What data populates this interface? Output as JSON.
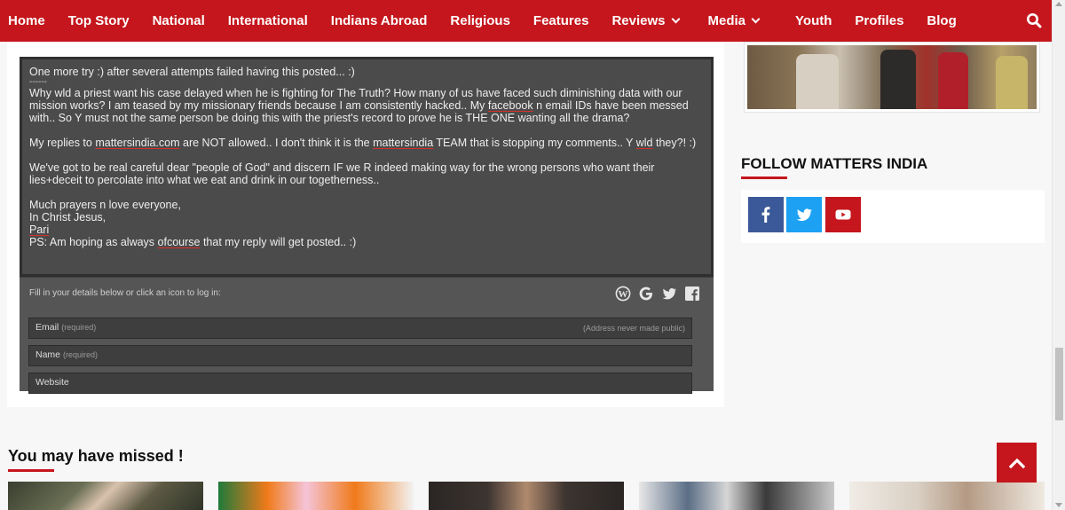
{
  "nav": {
    "items": [
      {
        "label": "Home"
      },
      {
        "label": "Top Story"
      },
      {
        "label": "National"
      },
      {
        "label": "International"
      },
      {
        "label": "Indians Abroad"
      },
      {
        "label": "Religious"
      },
      {
        "label": "Features"
      },
      {
        "label": "Reviews"
      },
      {
        "label": "Media"
      },
      {
        "label": "Youth"
      },
      {
        "label": "Profiles"
      },
      {
        "label": "Blog"
      }
    ],
    "search_icon": "search-icon"
  },
  "comment": {
    "line1": "One more try :) after several attempts failed having this posted... :)",
    "divider": "------",
    "p2_a": "Why wld a priest want his case delayed when he is fighting for The Truth? How many of us have faced such diminishing data with our mission works? I am teased by my missionary friends because I am consistently hacked.. My ",
    "p2_facebook": "facebook",
    "p2_b": " n email IDs have been messed with.. So Y must not the same person be doing this with the priest's record to prove he is THE ONE wanting all the drama?",
    "p3_a": "My replies to ",
    "p3_link": "mattersindia.com",
    "p3_b": " are NOT allowed.. I don't think it is the ",
    "p3_link2": "mattersindia",
    "p3_c": " TEAM that is stopping my comments.. Y ",
    "p3_wld": "wld",
    "p3_d": " they?! :)",
    "p4_a": "We've got to be real careful dear \"people of God\" and discern IF we R indeed making way for the wrong persons who want their lies+deceit to percolate into what we eat and drink in our togetherness..",
    "p5_l1": "Much prayers n love everyone,",
    "p5_l2": "In Christ Jesus,",
    "p5_l3": "Pari",
    "p5_l4a": "PS: Am hoping as always ",
    "p5_ofcourse": "ofcourse",
    "p5_l4b": " that my reply will get posted.. :)"
  },
  "form": {
    "hint": "Fill in your details below or click an icon to log in:",
    "login_icons": [
      "wordpress-icon",
      "google-icon",
      "twitter-icon",
      "facebook-icon"
    ],
    "email_label": "Email",
    "email_required": "(required)",
    "email_note": "(Address never made public)",
    "name_label": "Name",
    "name_required": "(required)",
    "website_label": "Website"
  },
  "sidebar": {
    "follow_title": "FOLLOW MATTERS INDIA",
    "social": [
      {
        "icon": "facebook-icon",
        "color": "#3b5998"
      },
      {
        "icon": "twitter-icon",
        "color": "#1da1f2"
      },
      {
        "icon": "youtube-icon",
        "color": "#c4161c"
      }
    ]
  },
  "missed": {
    "title": "You may have missed !"
  },
  "colors": {
    "brand_red": "#c4161c",
    "comment_bg": "#4b4b4b"
  }
}
